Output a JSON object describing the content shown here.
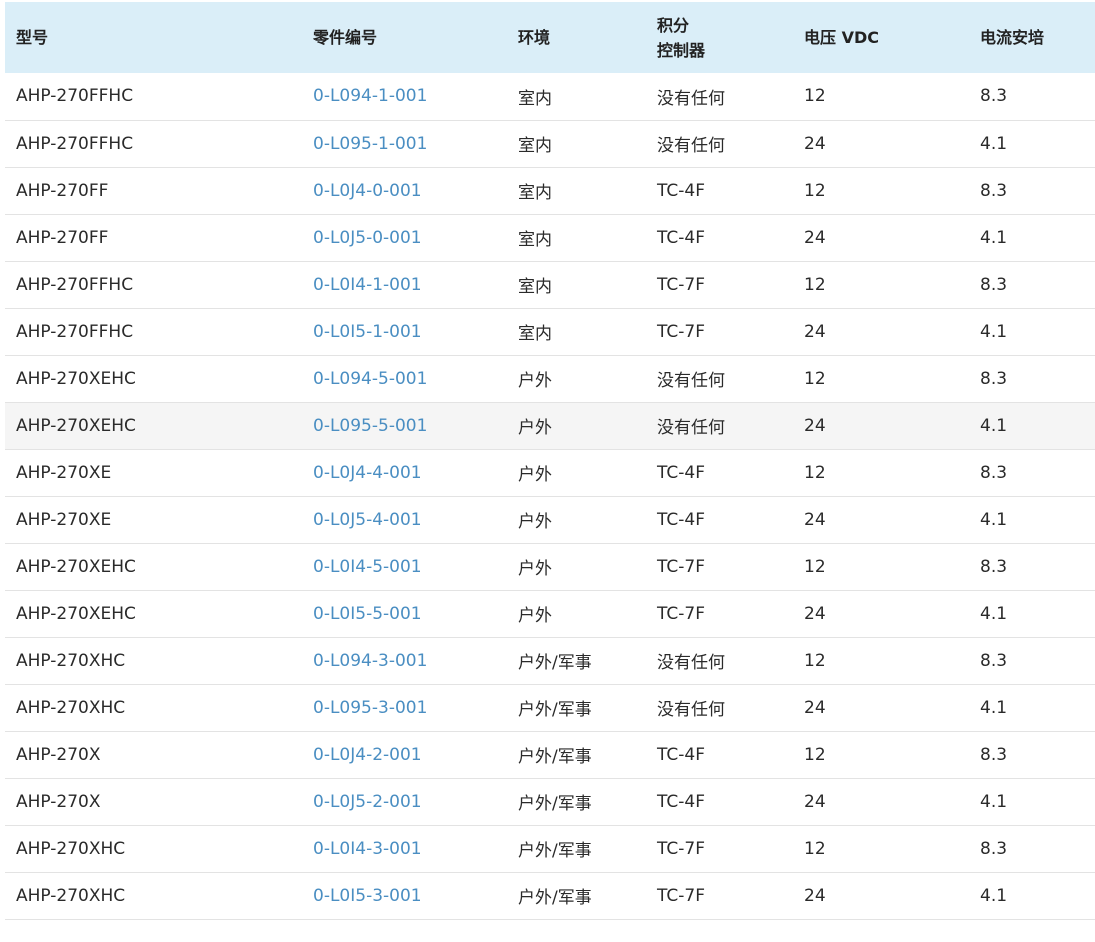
{
  "table": {
    "headers": [
      "型号",
      "零件编号",
      "环境",
      "积分",
      "控制器",
      "电压 VDC",
      "电流安培"
    ],
    "rows": [
      [
        "AHP-270FFHC",
        "0-L094-1-001",
        "室内",
        "没有任何",
        "12",
        "8.3"
      ],
      [
        "AHP-270FFHC",
        "0-L095-1-001",
        "室内",
        "没有任何",
        "24",
        "4.1"
      ],
      [
        "AHP-270FF",
        "0-L0J4-0-001",
        "室内",
        "TC-4F",
        "12",
        "8.3"
      ],
      [
        "AHP-270FF",
        "0-L0J5-0-001",
        "室内",
        "TC-4F",
        "24",
        "4.1"
      ],
      [
        "AHP-270FFHC",
        "0-L0I4-1-001",
        "室内",
        "TC-7F",
        "12",
        "8.3"
      ],
      [
        "AHP-270FFHC",
        "0-L0I5-1-001",
        "室内",
        "TC-7F",
        "24",
        "4.1"
      ],
      [
        "AHP-270XEHC",
        "0-L094-5-001",
        "户外",
        "没有任何",
        "12",
        "8.3"
      ],
      [
        "AHP-270XEHC",
        "0-L095-5-001",
        "户外",
        "没有任何",
        "24",
        "4.1"
      ],
      [
        "AHP-270XE",
        "0-L0J4-4-001",
        "户外",
        "TC-4F",
        "12",
        "8.3"
      ],
      [
        "AHP-270XE",
        "0-L0J5-4-001",
        "户外",
        "TC-4F",
        "24",
        "4.1"
      ],
      [
        "AHP-270XEHC",
        "0-L0I4-5-001",
        "户外",
        "TC-7F",
        "12",
        "8.3"
      ],
      [
        "AHP-270XEHC",
        "0-L0I5-5-001",
        "户外",
        "TC-7F",
        "24",
        "4.1"
      ],
      [
        "AHP-270XHC",
        "0-L094-3-001",
        "户外/军事",
        "没有任何",
        "12",
        "8.3"
      ],
      [
        "AHP-270XHC",
        "0-L095-3-001",
        "户外/军事",
        "没有任何",
        "24",
        "4.1"
      ],
      [
        "AHP-270X",
        "0-L0J4-2-001",
        "户外/军事",
        "TC-4F",
        "12",
        "8.3"
      ],
      [
        "AHP-270X",
        "0-L0J5-2-001",
        "户外/军事",
        "TC-4F",
        "24",
        "4.1"
      ],
      [
        "AHP-270XHC",
        "0-L0I4-3-001",
        "户外/军事",
        "TC-7F",
        "12",
        "8.3"
      ],
      [
        "AHP-270XHC",
        "0-L0I5-3-001",
        "户外/军事",
        "TC-7F",
        "24",
        "4.1"
      ]
    ]
  },
  "colors": {
    "header_bg": "#daeef8",
    "link": "#4a8ec2",
    "alt_row": "#f5f5f5",
    "divider": "#e3e3e3"
  }
}
